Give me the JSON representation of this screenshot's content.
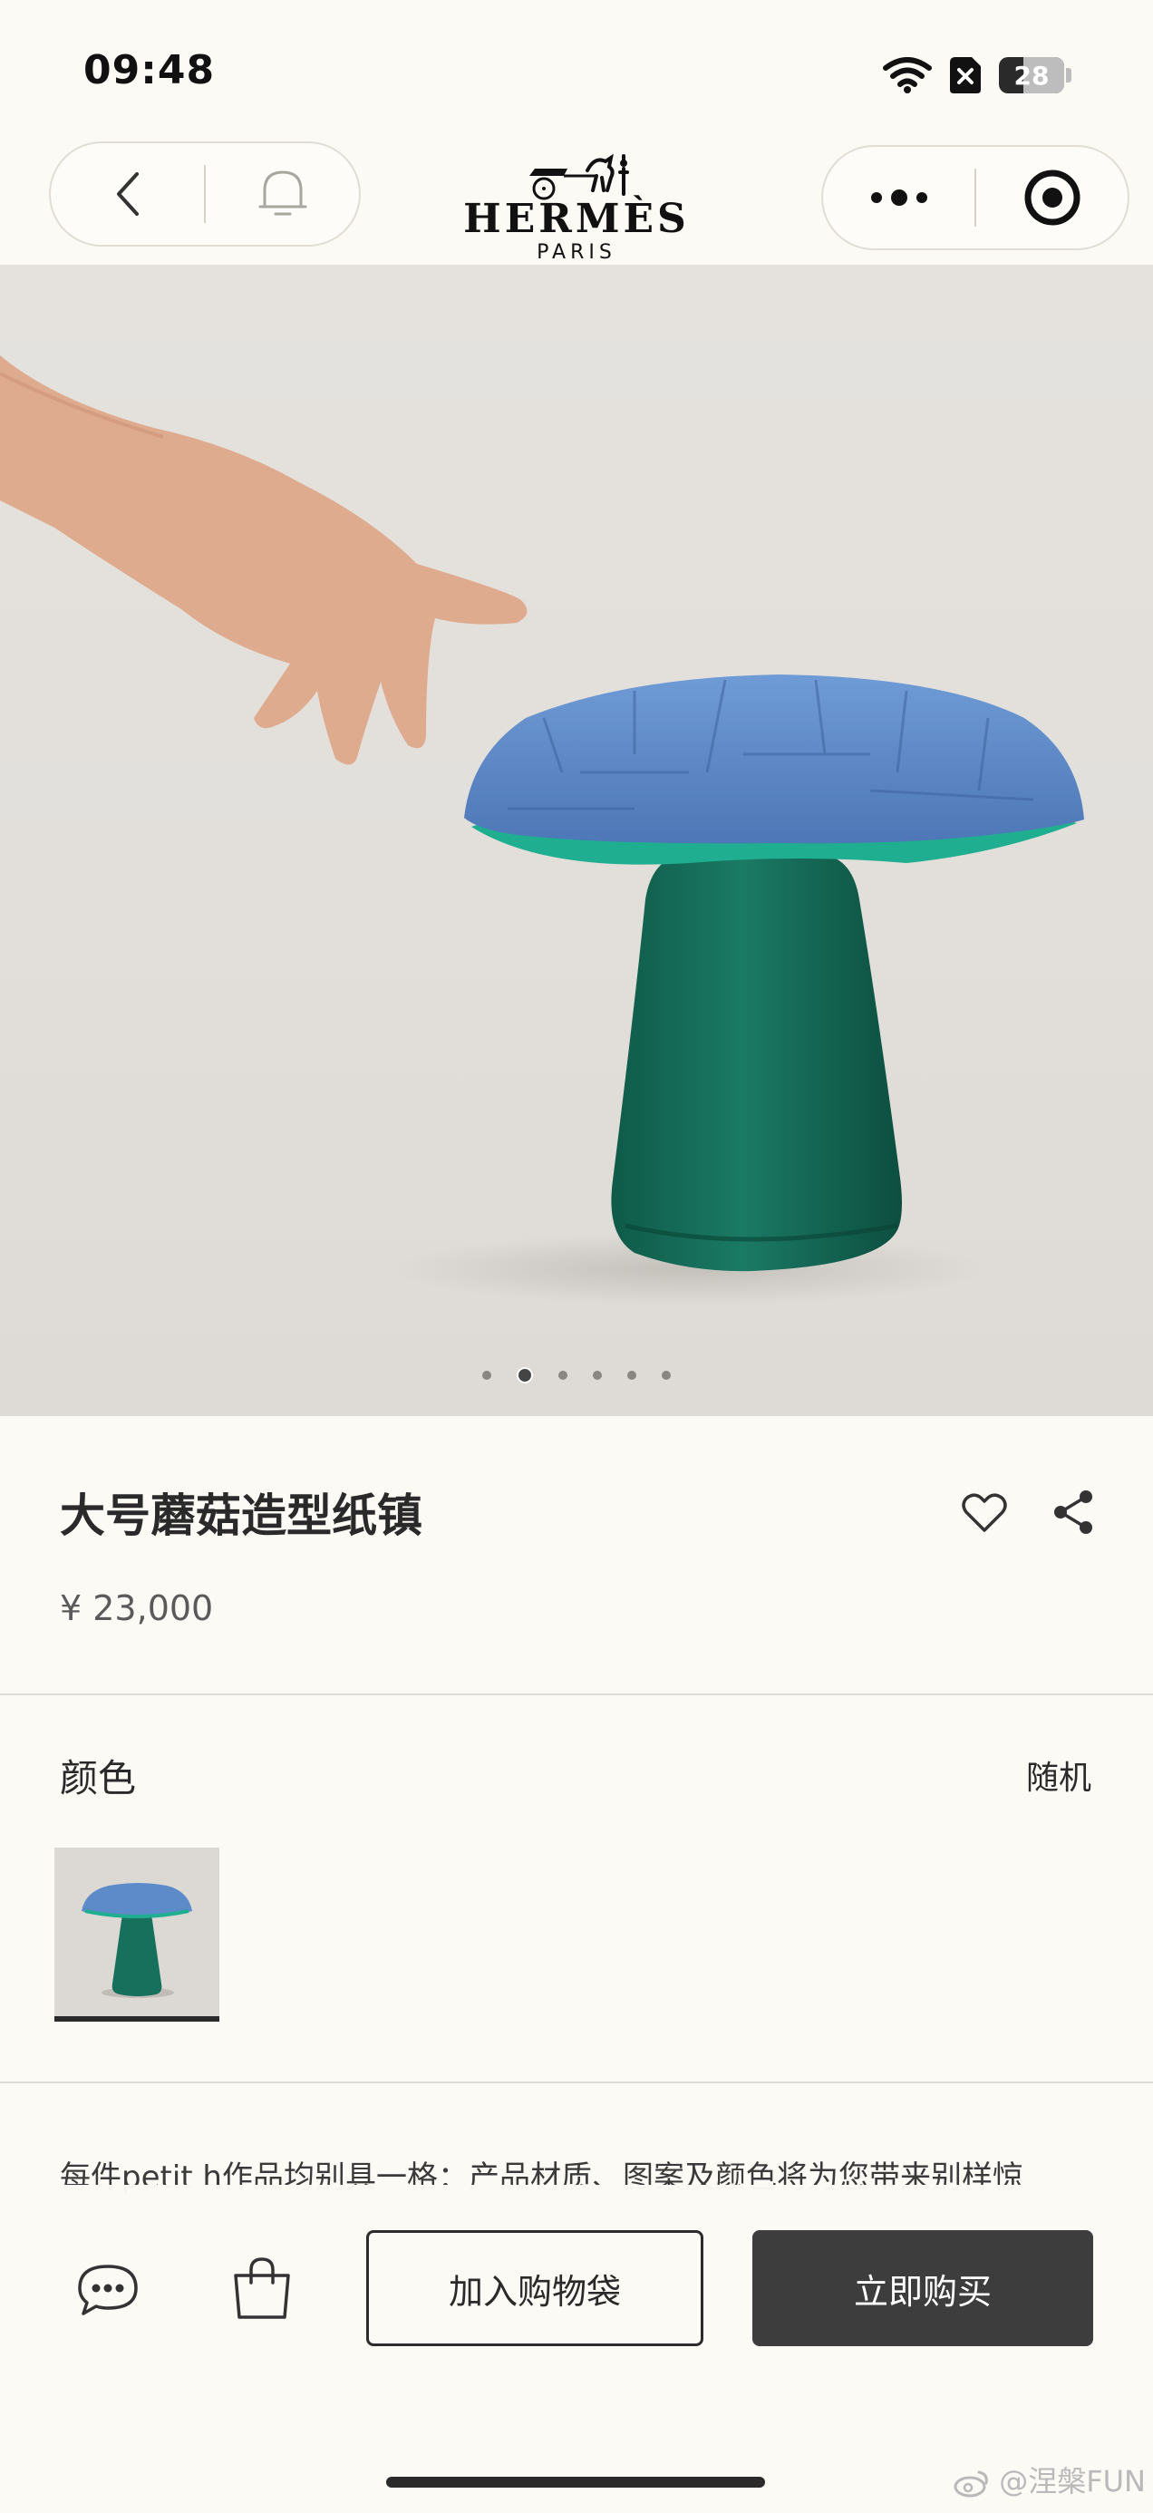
{
  "status": {
    "time": "09:48",
    "battery": "28",
    "icons": [
      "wifi-icon",
      "sim-off-icon",
      "battery-icon"
    ]
  },
  "header": {
    "brand": "HERMÈS",
    "brand_sub": "PARIS",
    "icons": [
      "back-icon",
      "bell-icon",
      "more-icon",
      "target-icon"
    ]
  },
  "gallery": {
    "image_count": 6,
    "active_index": 1
  },
  "product": {
    "title": "大号蘑菇造型纸镇",
    "price": "¥ 23,000",
    "icons": [
      "heart-icon",
      "share-icon"
    ]
  },
  "color": {
    "label": "颜色",
    "value": "随机"
  },
  "description": "每件petit h作品均别具一格：产品材质、图案及颜色将为您带来别样惊",
  "bottom": {
    "icons": [
      "chat-icon",
      "bag-icon"
    ],
    "add_to_bag": "加入购物袋",
    "buy_now": "立即购买"
  },
  "watermark": "@涅槃FUN",
  "colors": {
    "background": "#fcfaf5",
    "button_dark": "#3d3d3d",
    "cap_blue": "#5a86c4",
    "stem_green": "#17705c"
  }
}
